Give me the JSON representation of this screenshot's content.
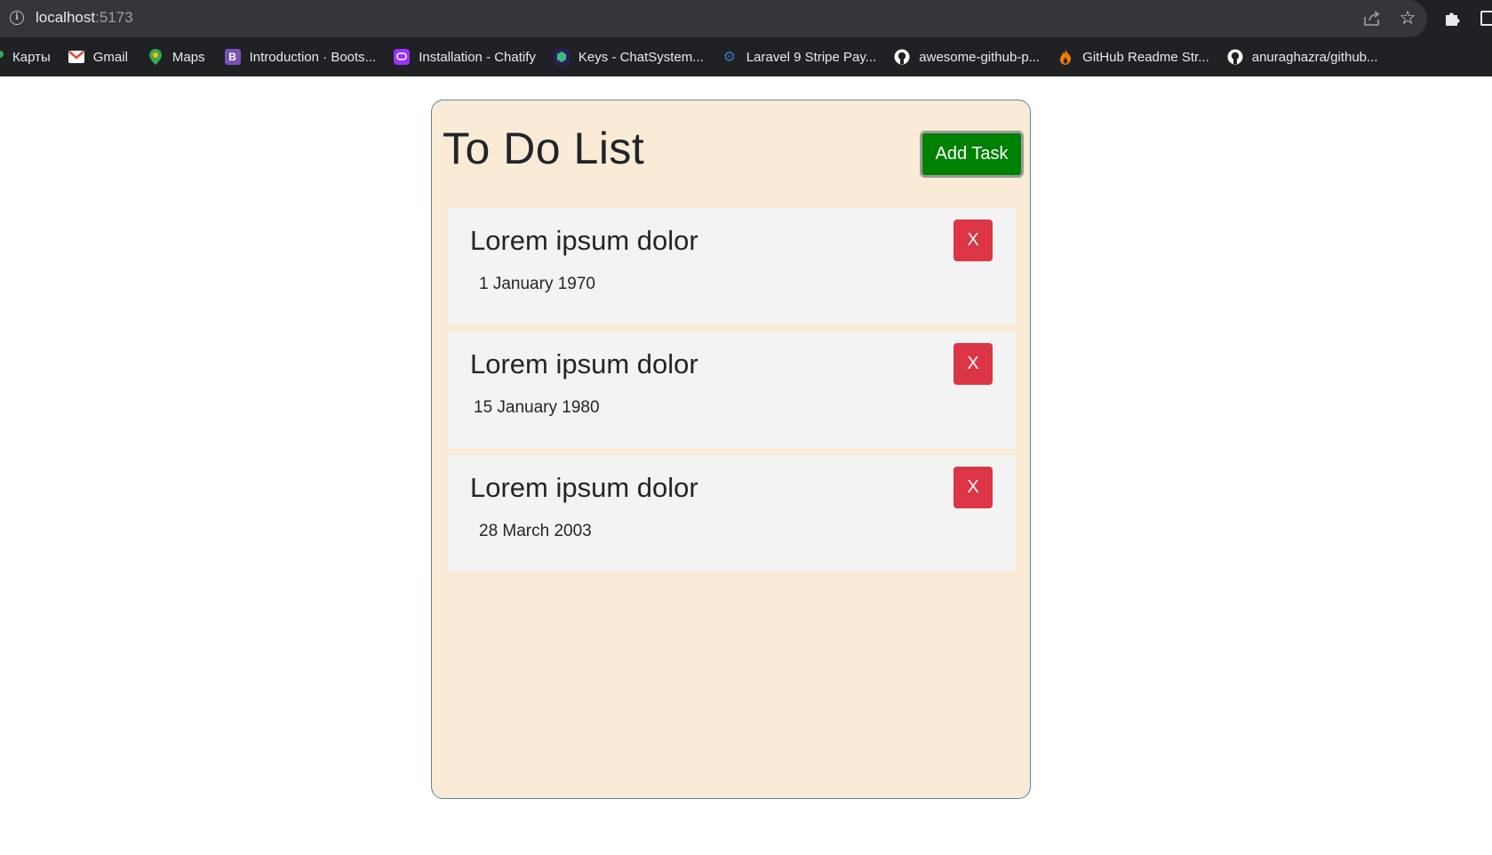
{
  "browser": {
    "url_host": "localhost",
    "url_port": ":5173",
    "bookmarks": [
      {
        "label": "Карты",
        "icon": "maps-pin-icon",
        "color": "#34a853"
      },
      {
        "label": "Gmail",
        "icon": "gmail-icon",
        "color": "#ea4335"
      },
      {
        "label": "Maps",
        "icon": "maps-pin-icon",
        "color": "#fbbc04"
      },
      {
        "label": "Introduction · Boots...",
        "icon": "bootstrap-icon",
        "color": "#7952b3"
      },
      {
        "label": "Installation - Chatify",
        "icon": "chatify-icon",
        "color": "#9b30ff"
      },
      {
        "label": "Keys - ChatSystem...",
        "icon": "cube-icon",
        "color": "#3d2a8a"
      },
      {
        "label": "Laravel 9 Stripe Pay...",
        "icon": "gear-icon",
        "color": "#3f6fb5"
      },
      {
        "label": "awesome-github-p...",
        "icon": "github-icon",
        "color": "#ffffff"
      },
      {
        "label": "GitHub Readme Str...",
        "icon": "flame-icon",
        "color": "#f57c00"
      },
      {
        "label": "anuraghazra/github...",
        "icon": "github-icon",
        "color": "#ffffff"
      }
    ]
  },
  "app": {
    "title": "To Do List",
    "add_button_label": "Add Task",
    "tasks": [
      {
        "title": "Lorem ipsum dolor",
        "date": "1 January 1970",
        "delete_label": "X"
      },
      {
        "title": "Lorem ipsum dolor",
        "date": "15 January 1980",
        "delete_label": "X"
      },
      {
        "title": "Lorem ipsum dolor",
        "date": "28 March 2003",
        "delete_label": "X"
      }
    ]
  },
  "colors": {
    "card_background": "#faebd7",
    "add_button": "#008000",
    "delete_button": "#dc3545",
    "task_background": "#f3f3f3"
  }
}
